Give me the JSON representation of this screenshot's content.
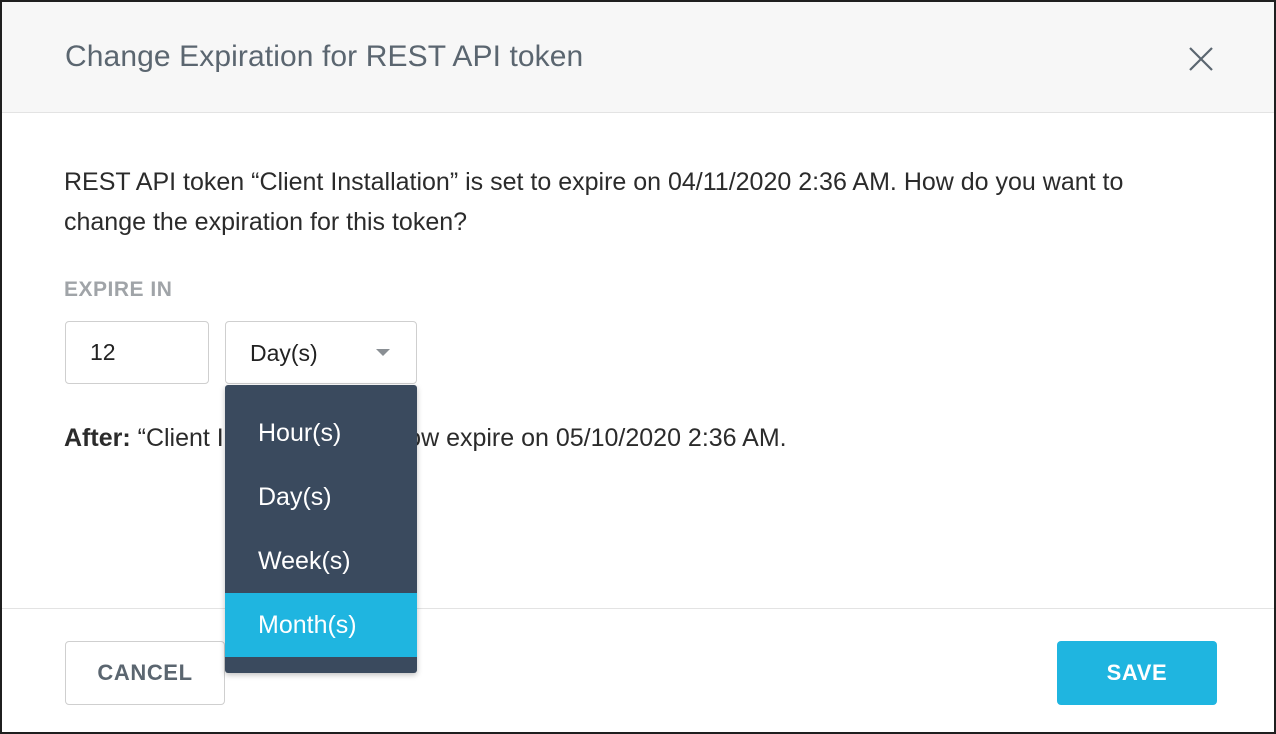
{
  "dialog": {
    "title": "Change Expiration for REST API token",
    "close_icon": "close-icon",
    "description": "REST API token “Client Installation” is set to expire on 04/11/2020 2:36 AM. How do you want to change the expiration for this token?"
  },
  "expire": {
    "label": "EXPIRE IN",
    "amount": "12",
    "unit_selected": "Day(s)",
    "caret_icon": "caret-down-icon"
  },
  "after": {
    "label": "After:",
    "text": "“Client Installation” will now expire on 05/10/2020 2:36 AM."
  },
  "dropdown": {
    "options": [
      "Hour(s)",
      "Day(s)",
      "Week(s)",
      "Month(s)"
    ],
    "highlighted": "Month(s)"
  },
  "footer": {
    "cancel_label": "CANCEL",
    "save_label": "SAVE"
  },
  "colors": {
    "accent": "#1fb5e0",
    "dropdown_bg": "#3a4a5e",
    "title_text": "#5b6670",
    "label_text": "#a0a4a8"
  }
}
